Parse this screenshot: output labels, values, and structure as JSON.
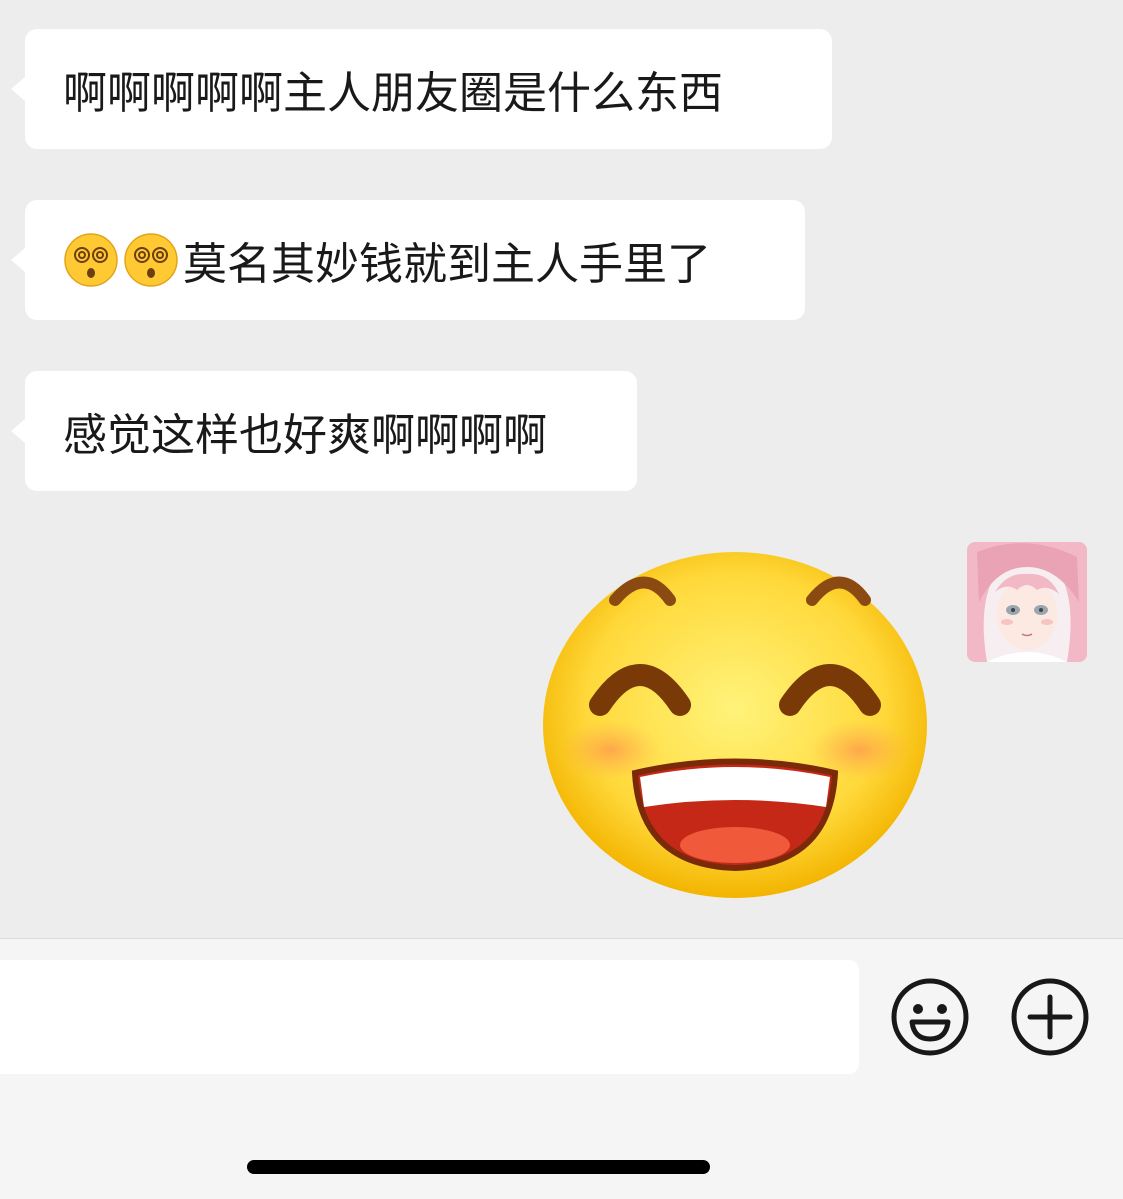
{
  "messages": [
    {
      "sender": "other",
      "text": "啊啊啊啊啊主人朋友圈是什么东西"
    },
    {
      "sender": "other",
      "text": "莫名其妙钱就到主人手里了",
      "leading_emojis": [
        "dizzy-face",
        "dizzy-face"
      ]
    },
    {
      "sender": "other",
      "text": "感觉这样也好爽啊啊啊啊"
    },
    {
      "sender": "self",
      "sticker": "grinning-face-sticker"
    }
  ],
  "input_bar": {
    "input_value": "",
    "emoji_button_icon": "smiley-icon",
    "more_button_icon": "plus-circle-icon"
  },
  "colors": {
    "chat_background": "#ededed",
    "bubble_other": "#ffffff",
    "input_bar_background": "#f5f5f5"
  }
}
